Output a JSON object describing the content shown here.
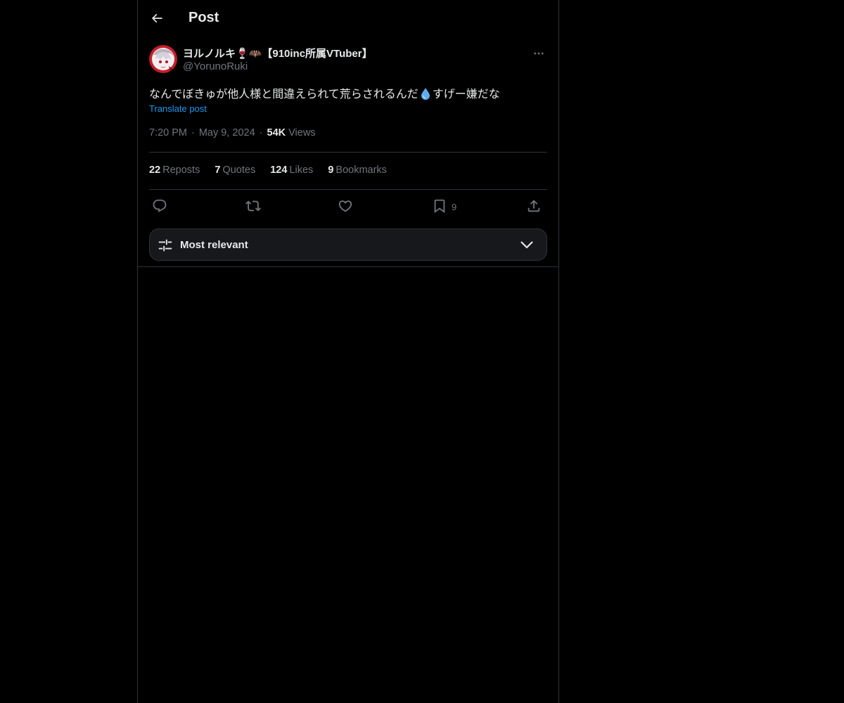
{
  "header": {
    "title": "Post",
    "back_icon": "arrow-left-icon"
  },
  "author": {
    "display_name": "ヨルノルキ🍷🦇【910inc所属VTuber】",
    "handle": "@YorunoRuki",
    "avatar_icon": "avatar-image"
  },
  "post": {
    "text_before": "なんでぼきゅが他人様と間違えられて荒らされるんだ",
    "text_emoji": "💧",
    "text_after": "すげー嫌だな",
    "translate_label": "Translate post",
    "time": "7:20 PM",
    "date": "May 9, 2024",
    "views_count": "54K",
    "views_label": "Views"
  },
  "stats": {
    "reposts_count": "22",
    "reposts_label": "Reposts",
    "quotes_count": "7",
    "quotes_label": "Quotes",
    "likes_count": "124",
    "likes_label": "Likes",
    "bookmarks_count": "9",
    "bookmarks_label": "Bookmarks"
  },
  "actions": {
    "reply_icon": "reply-icon",
    "repost_icon": "repost-icon",
    "like_icon": "heart-icon",
    "bookmark_icon": "bookmark-icon",
    "bookmark_count": "9",
    "share_icon": "share-icon"
  },
  "sort": {
    "label": "Most relevant",
    "icon": "sliders-icon"
  },
  "colors": {
    "background": "#000000",
    "text_primary": "#e7e9ea",
    "text_secondary": "#71767b",
    "accent": "#1d9bf0",
    "border": "#2f3336"
  }
}
